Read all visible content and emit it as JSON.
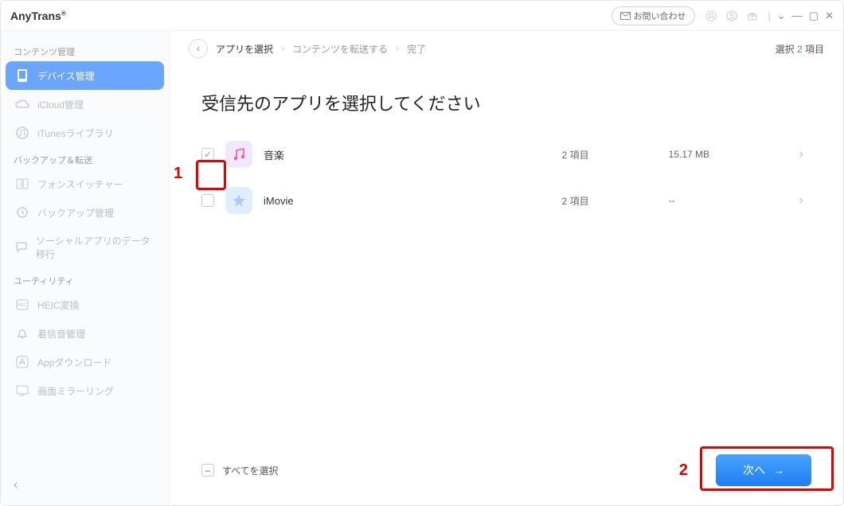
{
  "brand": {
    "name": "AnyTrans",
    "reg": "®"
  },
  "titlebar": {
    "contact": "お問い合わせ"
  },
  "sidebar": {
    "sections": [
      "コンテンツ管理",
      "バックアップ＆転送",
      "ユーティリティ"
    ],
    "items": [
      "デバイス管理",
      "iCloud管理",
      "iTunesライブラリ",
      "フォンスイッチャー",
      "バックアップ管理",
      "ソーシャルアプリのデータ移行",
      "HEIC変換",
      "着信音管理",
      "Appダウンロード",
      "画面ミラーリング"
    ]
  },
  "breadcrumb": [
    "アプリを選択",
    "コンテンツを転送する",
    "完了"
  ],
  "selection": {
    "prefix": "選択",
    "count": "2",
    "suffix": "項目"
  },
  "heading": "受信先のアプリを選択してください",
  "rows": [
    {
      "name": "音楽",
      "count": "2 項目",
      "size": "15.17 MB"
    },
    {
      "name": "iMovie",
      "count": "2 項目",
      "size": "--"
    }
  ],
  "footer": {
    "selectAll": "すべてを選択",
    "next": "次へ"
  },
  "annotations": [
    "1",
    "2"
  ]
}
